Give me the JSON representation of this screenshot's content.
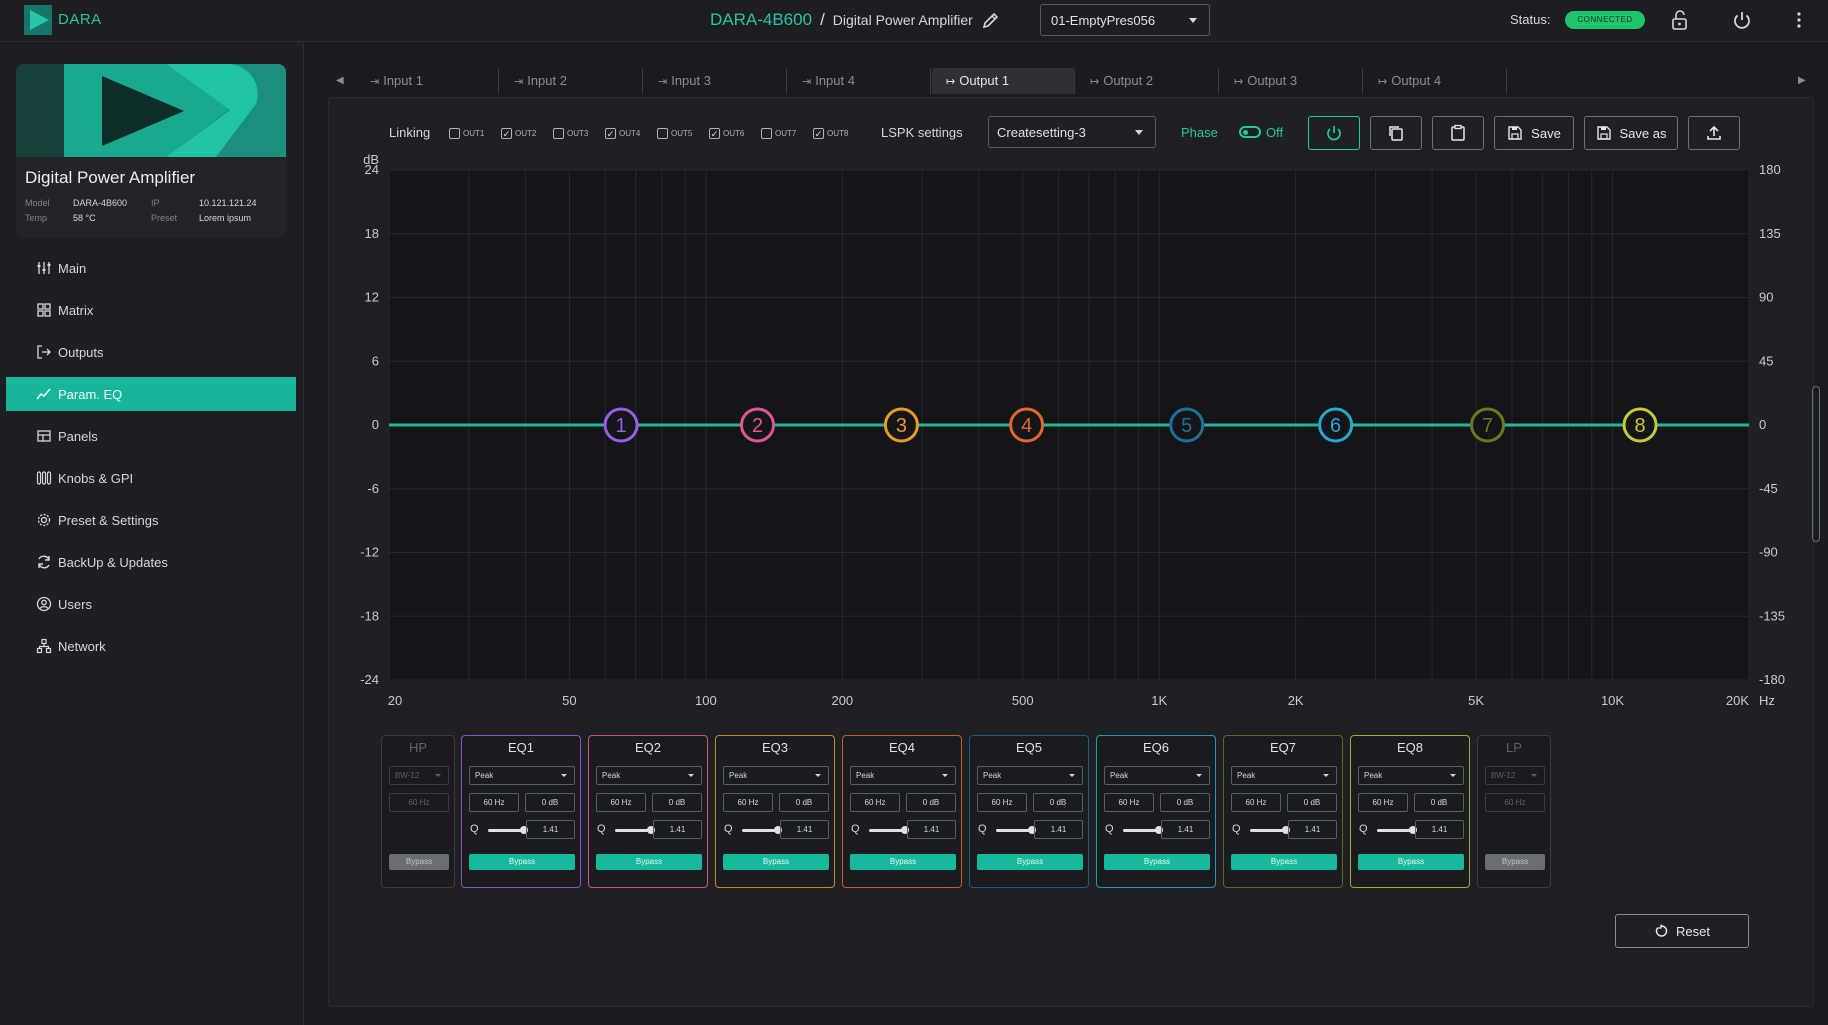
{
  "app": {
    "logo_text": "DARA"
  },
  "header": {
    "device_name": "DARA-4B600",
    "separator": "/",
    "device_desc": "Digital Power Amplifier",
    "preset_value": "01-EmptyPres056",
    "status_label": "Status:",
    "status_value": "CONNECTED"
  },
  "device_card": {
    "title": "Digital Power Amplifier",
    "model_label": "Model",
    "model_value": "DARA-4B600",
    "ip_label": "IP",
    "ip_value": "10.121.121.24",
    "temp_label": "Temp",
    "temp_value": "58 °C",
    "preset_label": "Preset",
    "preset_value": "Lorem ipsum"
  },
  "nav": [
    {
      "label": "Main",
      "icon": "sliders-icon"
    },
    {
      "label": "Matrix",
      "icon": "matrix-icon"
    },
    {
      "label": "Outputs",
      "icon": "output-icon"
    },
    {
      "label": "Param. EQ",
      "icon": "eq-curve-icon",
      "active": true
    },
    {
      "label": "Panels",
      "icon": "panel-icon"
    },
    {
      "label": "Knobs & GPI",
      "icon": "knobs-icon"
    },
    {
      "label": "Preset & Settings",
      "icon": "gear-icon"
    },
    {
      "label": "BackUp & Updates",
      "icon": "sync-icon"
    },
    {
      "label": "Users",
      "icon": "user-icon"
    },
    {
      "label": "Network",
      "icon": "network-icon"
    }
  ],
  "tabs": [
    "Input 1",
    "Input 2",
    "Input 3",
    "Input 4",
    "Output 1",
    "Output 2",
    "Output 3",
    "Output 4"
  ],
  "active_tab": "Output 1",
  "toolbar": {
    "linking_label": "Linking",
    "outputs": [
      {
        "label": "OUT1",
        "checked": false
      },
      {
        "label": "OUT2",
        "checked": true
      },
      {
        "label": "OUT3",
        "checked": false
      },
      {
        "label": "OUT4",
        "checked": true
      },
      {
        "label": "OUT5",
        "checked": false
      },
      {
        "label": "OUT6",
        "checked": true
      },
      {
        "label": "OUT7",
        "checked": false
      },
      {
        "label": "OUT8",
        "checked": true
      }
    ],
    "lspk_label": "LSPK settings",
    "lspk_value": "Createsetting-3",
    "phase_label": "Phase",
    "phase_state": "Off",
    "save_label": "Save",
    "save_as_label": "Save as"
  },
  "graph": {
    "y_unit": "dB",
    "x_unit": "Hz",
    "y_ticks": [
      "24",
      "18",
      "12",
      "6",
      "0",
      "-6",
      "-12",
      "-18",
      "-24"
    ],
    "y2_ticks": [
      "180",
      "135",
      "90",
      "45",
      "0",
      "-45",
      "-90",
      "-135",
      "-180"
    ],
    "x_ticks": [
      {
        "label": "20",
        "f": 20
      },
      {
        "label": "50",
        "f": 50
      },
      {
        "label": "100",
        "f": 100
      },
      {
        "label": "200",
        "f": 200
      },
      {
        "label": "500",
        "f": 500
      },
      {
        "label": "1K",
        "f": 1000
      },
      {
        "label": "2K",
        "f": 2000
      },
      {
        "label": "5K",
        "f": 5000
      },
      {
        "label": "10K",
        "f": 10000
      },
      {
        "label": "20K",
        "f": 20000
      }
    ],
    "points": [
      {
        "n": "1",
        "f": 65,
        "db": 0,
        "color": "#9b5de5"
      },
      {
        "n": "2",
        "f": 130,
        "db": 0,
        "color": "#e0559a"
      },
      {
        "n": "3",
        "f": 270,
        "db": 0,
        "color": "#e79b2a"
      },
      {
        "n": "4",
        "f": 510,
        "db": 0,
        "color": "#e2672f"
      },
      {
        "n": "5",
        "f": 1150,
        "db": 0,
        "color": "#1f6f9a"
      },
      {
        "n": "6",
        "f": 2450,
        "db": 0,
        "color": "#2aa7d0"
      },
      {
        "n": "7",
        "f": 5300,
        "db": 0,
        "color": "#6a7a1e"
      },
      {
        "n": "8",
        "f": 11500,
        "db": 0,
        "color": "#c8c93a"
      }
    ]
  },
  "bands": [
    {
      "title": "HP",
      "type": "BW-12",
      "freq": "60 Hz",
      "bypass": "Bypass",
      "dim": true
    },
    {
      "title": "EQ1",
      "type": "Peak",
      "freq": "60 Hz",
      "gain": "0 dB",
      "q_label": "Q",
      "q": "1.41",
      "bypass": "Bypass",
      "color": "#8a4fd8"
    },
    {
      "title": "EQ2",
      "type": "Peak",
      "freq": "60 Hz",
      "gain": "0 dB",
      "q_label": "Q",
      "q": "1.41",
      "bypass": "Bypass",
      "color": "#d64f8c"
    },
    {
      "title": "EQ3",
      "type": "Peak",
      "freq": "60 Hz",
      "gain": "0 dB",
      "q_label": "Q",
      "q": "1.41",
      "bypass": "Bypass",
      "color": "#c98a22"
    },
    {
      "title": "EQ4",
      "type": "Peak",
      "freq": "60 Hz",
      "gain": "0 dB",
      "q_label": "Q",
      "q": "1.41",
      "bypass": "Bypass",
      "color": "#cc5a26"
    },
    {
      "title": "EQ5",
      "type": "Peak",
      "freq": "60 Hz",
      "gain": "0 dB",
      "q_label": "Q",
      "q": "1.41",
      "bypass": "Bypass",
      "color": "#1d5e82"
    },
    {
      "title": "EQ6",
      "type": "Peak",
      "freq": "60 Hz",
      "gain": "0 dB",
      "q_label": "Q",
      "q": "1.41",
      "bypass": "Bypass",
      "color": "#2596bb"
    },
    {
      "title": "EQ7",
      "type": "Peak",
      "freq": "60 Hz",
      "gain": "0 dB",
      "q_label": "Q",
      "q": "1.41",
      "bypass": "Bypass",
      "color": "#5c6a1c"
    },
    {
      "title": "EQ8",
      "type": "Peak",
      "freq": "60 Hz",
      "gain": "0 dB",
      "q_label": "Q",
      "q": "1.41",
      "bypass": "Bypass",
      "color": "#a9aa30"
    },
    {
      "title": "LP",
      "type": "BW-12",
      "freq": "60 Hz",
      "bypass": "Bypass",
      "dim": true
    }
  ],
  "reset_label": "Reset",
  "colors": {
    "accent": "#26c6a6",
    "status_green": "#1fc46f",
    "curve": "#20b89c"
  }
}
